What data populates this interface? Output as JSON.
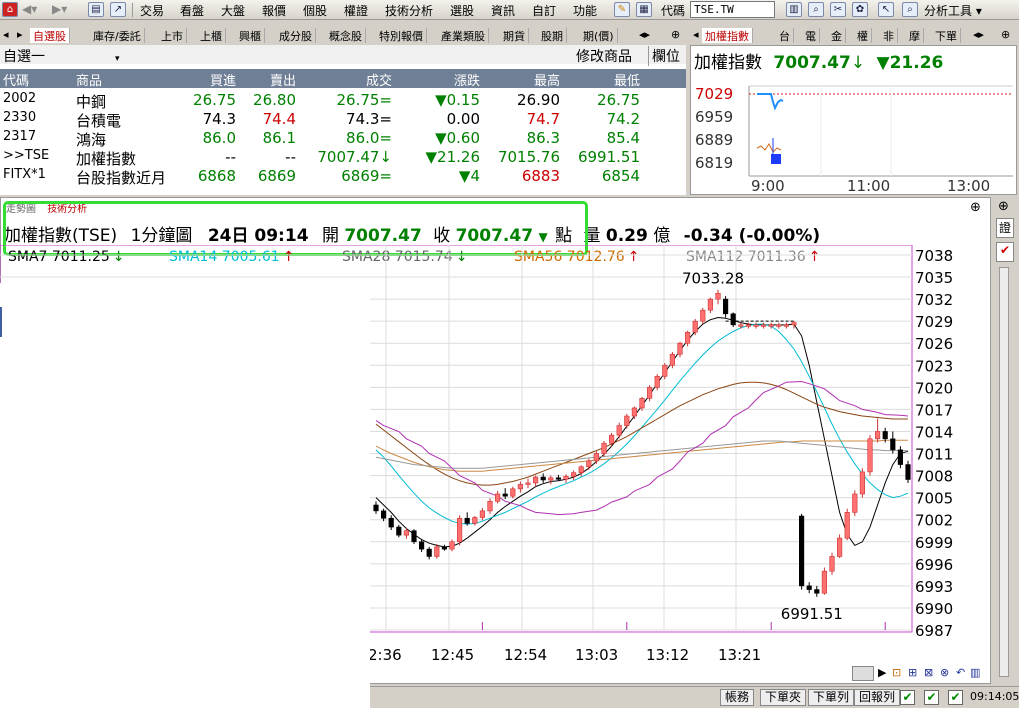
{
  "toolbar": {
    "menus": [
      "交易",
      "看盤",
      "大盤",
      "報價",
      "個股",
      "權證",
      "技術分析",
      "選股",
      "資訊",
      "自訂",
      "功能"
    ],
    "code_label": "代碼",
    "code_value": "TSE.TW",
    "analysis_tools": "分析工具"
  },
  "quote_tabs": [
    "自選股",
    "庫存/委託",
    "上市",
    "上櫃",
    "興櫃",
    "成分股",
    "概念股",
    "特別報價",
    "產業類股",
    "期貨",
    "股期",
    "期(價)"
  ],
  "quote_panel": {
    "group_select": "自選一",
    "modify_btn": "修改商品",
    "column_btn": "欄位",
    "headers": [
      "代碼",
      "商品",
      "買進",
      "賣出",
      "成交",
      "漲跌",
      "最高",
      "最低"
    ],
    "rows": [
      {
        "code": "2002",
        "name": "中鋼",
        "bid": "26.75",
        "ask": "26.80",
        "last": "26.75=",
        "chg": "▼0.15",
        "high": "26.90",
        "low": "26.75",
        "bid_c": "green",
        "ask_c": "green",
        "last_c": "green",
        "chg_c": "green",
        "high_c": "black",
        "low_c": "green"
      },
      {
        "code": "2330",
        "name": "台積電",
        "bid": "74.3",
        "ask": "74.4",
        "last": "74.3=",
        "chg": "0.00",
        "high": "74.7",
        "low": "74.2",
        "bid_c": "black",
        "ask_c": "red",
        "last_c": "black",
        "chg_c": "black",
        "high_c": "red",
        "low_c": "green"
      },
      {
        "code": "2317",
        "name": "鴻海",
        "bid": "86.0",
        "ask": "86.1",
        "last": "86.0=",
        "chg": "▼0.60",
        "high": "86.3",
        "low": "85.4",
        "bid_c": "green",
        "ask_c": "green",
        "last_c": "green",
        "chg_c": "green",
        "high_c": "green",
        "low_c": "green"
      },
      {
        "code": ">>TSE",
        "name": "加權指數",
        "bid": "--",
        "ask": "--",
        "last": "7007.47↓",
        "chg": "▼21.26",
        "high": "7015.76",
        "low": "6991.51",
        "bid_c": "black",
        "ask_c": "black",
        "last_c": "green",
        "chg_c": "green",
        "high_c": "green",
        "low_c": "green"
      },
      {
        "code": "FITX*1",
        "name": "台股指數近月",
        "bid": "6868",
        "ask": "6869",
        "last": "6869=",
        "chg": "▼4",
        "high": "6883",
        "low": "6854",
        "bid_c": "green",
        "ask_c": "green",
        "last_c": "green",
        "chg_c": "green",
        "high_c": "red",
        "low_c": "green"
      }
    ]
  },
  "mini_tabs": [
    "加權指數",
    "台",
    "電",
    "金",
    "權",
    "非",
    "摩",
    "下單"
  ],
  "mini_panel": {
    "title": "加權指數",
    "value": "7007.47",
    "arrow": "↓",
    "change": "▼21.26",
    "y_ticks": [
      "7029",
      "6959",
      "6889",
      "6819"
    ],
    "x_ticks": [
      "9:00",
      "11:00",
      "13:00"
    ]
  },
  "chart_tabs": [
    "走勢圖",
    "技術分析"
  ],
  "chart_header": {
    "name": "加權指數(TSE)",
    "period": "1分鐘圖",
    "date_time": "24日 09:14",
    "open_label": "開",
    "open_value": "7007.47",
    "close_label": "收",
    "close_value": "7007.47",
    "close_arrow": "▼",
    "unit": "點",
    "volume_label": "量",
    "volume_value": "0.29",
    "volume_unit": "億",
    "change": "-0.34 (-0.00%)"
  },
  "chart_data": {
    "type": "candlestick",
    "title": "",
    "y_ticks": [
      7038,
      7035,
      7032,
      7029,
      7026,
      7023,
      7020,
      7017,
      7014,
      7011,
      7008,
      7005,
      7002,
      6999,
      6996,
      6993,
      6990,
      6987
    ],
    "ylim": [
      6987,
      7038
    ],
    "x_ticks": [
      "2:36",
      "12:45",
      "12:54",
      "13:03",
      "13:12",
      "13:21"
    ],
    "ma_legend": [
      {
        "label": "SMA7 7011.25",
        "arrow": "↓",
        "color": "#000000"
      },
      {
        "label": "SMA14 7005.61",
        "arrow": "↑",
        "color": "#00bcd4"
      },
      {
        "label": "SMA28 7015.74",
        "arrow": "↓",
        "color": "#666666"
      },
      {
        "label": "SMA56 7012.76",
        "arrow": "↑",
        "color": "#cc6a00"
      },
      {
        "label": "SMA112 7011.36",
        "arrow": "↑",
        "color": "#888888"
      }
    ],
    "high_label": "7033.28",
    "low_label": "6991.51",
    "candles": [
      [
        7004.0,
        7004.5,
        7002.8,
        7003.2
      ],
      [
        7003.2,
        7003.5,
        7001.8,
        7002.2
      ],
      [
        7002.2,
        7002.6,
        7000.6,
        7001.0
      ],
      [
        7001.0,
        7001.3,
        6999.6,
        6999.9
      ],
      [
        6999.9,
        7000.9,
        6999.4,
        7000.5
      ],
      [
        7000.5,
        7000.7,
        6998.7,
        6999.0
      ],
      [
        6999.0,
        6999.3,
        6997.6,
        6998.0
      ],
      [
        6998.0,
        6998.3,
        6996.6,
        6997.0
      ],
      [
        6997.0,
        6998.7,
        6996.7,
        6998.3
      ],
      [
        6998.3,
        6998.6,
        6997.8,
        6998.0
      ],
      [
        6998.0,
        6999.3,
        6997.7,
        6999.0
      ],
      [
        6999.0,
        7002.6,
        6998.5,
        7002.2
      ],
      [
        7002.2,
        7003.0,
        7001.2,
        7001.5
      ],
      [
        7001.5,
        7002.5,
        7001.2,
        7002.3
      ],
      [
        7002.3,
        7003.6,
        7001.9,
        7003.2
      ],
      [
        7003.2,
        7004.9,
        7002.8,
        7004.5
      ],
      [
        7004.5,
        7005.9,
        7004.2,
        7005.5
      ],
      [
        7005.5,
        7006.3,
        7004.8,
        7005.2
      ],
      [
        7005.2,
        7006.5,
        7004.9,
        7006.2
      ],
      [
        7006.2,
        7007.2,
        7005.7,
        7006.8
      ],
      [
        7006.8,
        7007.6,
        7006.3,
        7007.0
      ],
      [
        7007.0,
        7008.0,
        7006.5,
        7007.8
      ],
      [
        7007.8,
        7008.3,
        7007.0,
        7007.4
      ],
      [
        7007.4,
        7008.0,
        7006.8,
        7007.7
      ],
      [
        7007.7,
        7008.1,
        7007.3,
        7007.5
      ],
      [
        7007.5,
        7008.2,
        7007.0,
        7007.9
      ],
      [
        7007.9,
        7008.7,
        7007.4,
        7008.4
      ],
      [
        7008.4,
        7009.4,
        7007.9,
        7009.2
      ],
      [
        7009.2,
        7010.3,
        7008.8,
        7010.0
      ],
      [
        7010.0,
        7011.3,
        7009.6,
        7011.0
      ],
      [
        7011.0,
        7012.7,
        7010.6,
        7012.4
      ],
      [
        7012.4,
        7013.8,
        7012.0,
        7013.5
      ],
      [
        7013.5,
        7015.2,
        7013.1,
        7014.8
      ],
      [
        7014.8,
        7016.4,
        7014.4,
        7016.1
      ],
      [
        7016.1,
        7017.4,
        7015.7,
        7017.2
      ],
      [
        7017.2,
        7018.7,
        7016.8,
        7018.5
      ],
      [
        7018.5,
        7020.3,
        7018.1,
        7020.0
      ],
      [
        7020.0,
        7021.8,
        7019.6,
        7021.5
      ],
      [
        7021.5,
        7023.3,
        7021.1,
        7023.0
      ],
      [
        7023.0,
        7024.8,
        7022.6,
        7024.5
      ],
      [
        7024.5,
        7026.2,
        7024.1,
        7026.0
      ],
      [
        7026.0,
        7027.7,
        7025.6,
        7027.5
      ],
      [
        7027.5,
        7029.3,
        7027.1,
        7029.0
      ],
      [
        7029.0,
        7030.8,
        7028.6,
        7030.5
      ],
      [
        7030.5,
        7032.2,
        7030.1,
        7032.0
      ],
      [
        7032.0,
        7033.28,
        7031.3,
        7032.8
      ],
      [
        7032.0,
        7032.4,
        7029.5,
        7030.0
      ],
      [
        7030.0,
        7030.2,
        7028.2,
        7028.5
      ],
      [
        7028.5,
        7028.8,
        7028.0,
        7028.5
      ],
      [
        7028.5,
        7028.8,
        7028.0,
        7028.5
      ],
      [
        7028.5,
        7028.8,
        7028.0,
        7028.5
      ],
      [
        7028.5,
        7028.8,
        7028.0,
        7028.5
      ],
      [
        7028.5,
        7028.8,
        7028.0,
        7028.5
      ],
      [
        7028.5,
        7028.8,
        7028.0,
        7028.5
      ],
      [
        7028.5,
        7028.8,
        7028.0,
        7028.5
      ],
      [
        7028.5,
        7029.0,
        7028.0,
        7028.8
      ],
      [
        7002.5,
        7002.8,
        6992.5,
        6993.0
      ],
      [
        6993.0,
        6993.5,
        6992.0,
        6992.5
      ],
      [
        6992.5,
        6993.0,
        6991.51,
        6992.0
      ],
      [
        6992.0,
        6995.5,
        6991.8,
        6995.0
      ],
      [
        6995.0,
        6997.5,
        6994.5,
        6997.0
      ],
      [
        6997.0,
        7000.0,
        6996.8,
        6999.5
      ],
      [
        6999.5,
        7003.5,
        6999.2,
        7003.0
      ],
      [
        7003.0,
        7006.0,
        7002.5,
        7005.5
      ],
      [
        7005.5,
        7009.0,
        7005.0,
        7008.5
      ],
      [
        7008.5,
        7013.5,
        7008.0,
        7013.0
      ],
      [
        7013.0,
        7015.76,
        7012.5,
        7014.0
      ],
      [
        7014.0,
        7014.5,
        7012.5,
        7013.0
      ],
      [
        7013.0,
        7014.0,
        7011.0,
        7011.5
      ],
      [
        7011.5,
        7012.0,
        7009.0,
        7009.5
      ],
      [
        7009.5,
        7010.0,
        7007.0,
        7007.47
      ]
    ],
    "ma_lines": {
      "sma7": [
        7005.0,
        7004.0,
        7003.0,
        7001.8,
        7000.8,
        7000.0,
        6999.3,
        6998.8,
        6998.5,
        6998.3,
        6998.4,
        6998.8,
        6999.5,
        7000.3,
        7001.1,
        7002.0,
        7003.0,
        7003.8,
        7004.5,
        7005.2,
        7005.8,
        7006.5,
        7006.9,
        7007.2,
        7007.3,
        7007.5,
        7007.8,
        7008.3,
        7009.0,
        7009.9,
        7010.9,
        7012.0,
        7013.3,
        7014.7,
        7016.1,
        7017.5,
        7019.0,
        7020.5,
        7022.0,
        7023.5,
        7025.0,
        7026.4,
        7027.6,
        7028.6,
        7029.2,
        7029.5,
        7029.4,
        7029.1,
        7028.8,
        7028.6,
        7028.5,
        7028.5,
        7028.5,
        7028.5,
        7028.5,
        7028.6,
        7027.0,
        7023.0,
        7018.0,
        7013.0,
        7008.0,
        7003.0,
        7000.0,
        6998.5,
        6999.0,
        7001.0,
        7004.0,
        7007.0,
        7009.5,
        7011.0,
        7011.3
      ],
      "sma14": [
        7011.5,
        7010.5,
        7009.3,
        7008.0,
        7006.8,
        7005.6,
        7004.5,
        7003.6,
        7002.9,
        7002.3,
        7001.8,
        7001.5,
        7001.4,
        7001.5,
        7001.8,
        7002.2,
        7002.6,
        7003.0,
        7003.5,
        7004.0,
        7004.5,
        7005.1,
        7005.6,
        7006.1,
        7006.5,
        7006.9,
        7007.3,
        7007.8,
        7008.3,
        7008.9,
        7009.6,
        7010.4,
        7011.3,
        7012.3,
        7013.4,
        7014.6,
        7015.8,
        7017.0,
        7018.3,
        7019.6,
        7020.9,
        7022.1,
        7023.3,
        7024.4,
        7025.4,
        7026.3,
        7027.0,
        7027.6,
        7028.1,
        7028.4,
        7028.6,
        7028.6,
        7028.3,
        7027.6,
        7026.5,
        7025.2,
        7023.5,
        7021.5,
        7019.4,
        7017.2,
        7015.0,
        7013.0,
        7011.2,
        7009.6,
        7008.2,
        7007.0,
        7006.1,
        7005.4,
        7005.0,
        7005.2,
        7005.6
      ],
      "sma28": [
        7015.0,
        7014.2,
        7013.4,
        7012.6,
        7011.8,
        7011.0,
        7010.2,
        7009.5,
        7008.8,
        7008.2,
        7007.7,
        7007.3,
        7007.0,
        7006.8,
        7006.7,
        7006.7,
        7006.8,
        7007.0,
        7007.2,
        7007.5,
        7007.8,
        7008.2,
        7008.6,
        7009.0,
        7009.4,
        7009.8,
        7010.2,
        7010.6,
        7011.0,
        7011.4,
        7011.8,
        7012.3,
        7012.8,
        7013.3,
        7013.9,
        7014.5,
        7015.1,
        7015.7,
        7016.3,
        7016.9,
        7017.5,
        7018.0,
        7018.5,
        7019.0,
        7019.4,
        7019.8,
        7020.1,
        7020.4,
        7020.6,
        7020.7,
        7020.7,
        7020.6,
        7020.4,
        7020.1,
        7019.7,
        7019.2,
        7018.7,
        7018.2,
        7017.7,
        7017.3,
        7017.0,
        7016.7,
        7016.5,
        7016.3,
        7016.1,
        7016.0,
        7015.9,
        7015.8,
        7015.7,
        7015.7,
        7015.7
      ],
      "sma56": [
        7012.0,
        7011.5,
        7011.0,
        7010.6,
        7010.2,
        7009.8,
        7009.5,
        7009.2,
        7009.0,
        7008.8,
        7008.7,
        7008.6,
        7008.6,
        7008.6,
        7008.6,
        7008.7,
        7008.8,
        7008.9,
        7009.0,
        7009.1,
        7009.2,
        7009.3,
        7009.4,
        7009.5,
        7009.6,
        7009.7,
        7009.8,
        7009.9,
        7010.0,
        7010.1,
        7010.2,
        7010.3,
        7010.4,
        7010.5,
        7010.6,
        7010.7,
        7010.8,
        7010.9,
        7011.0,
        7011.1,
        7011.2,
        7011.3,
        7011.4,
        7011.5,
        7011.6,
        7011.7,
        7011.8,
        7011.9,
        7012.0,
        7012.1,
        7012.2,
        7012.3,
        7012.4,
        7012.5,
        7012.6,
        7012.6,
        7012.7,
        7012.7,
        7012.7,
        7012.7,
        7012.7,
        7012.7,
        7012.7,
        7012.7,
        7012.7,
        7012.7,
        7012.7,
        7012.8,
        7012.8,
        7012.8,
        7012.8
      ],
      "sma112": [
        7010.5,
        7010.3,
        7010.1,
        7009.9,
        7009.7,
        7009.5,
        7009.4,
        7009.3,
        7009.2,
        7009.1,
        7009.0,
        7009.0,
        7009.0,
        7009.0,
        7009.0,
        7009.1,
        7009.2,
        7009.3,
        7009.4,
        7009.5,
        7009.6,
        7009.7,
        7009.8,
        7009.9,
        7010.0,
        7010.1,
        7010.2,
        7010.3,
        7010.4,
        7010.5,
        7010.6,
        7010.7,
        7010.8,
        7010.9,
        7011.0,
        7011.1,
        7011.2,
        7011.3,
        7011.4,
        7011.5,
        7011.6,
        7011.7,
        7011.8,
        7011.9,
        7012.0,
        7012.1,
        7012.2,
        7012.3,
        7012.4,
        7012.5,
        7012.6,
        7012.7,
        7012.7,
        7012.7,
        7012.6,
        7012.5,
        7012.4,
        7012.3,
        7012.2,
        7012.1,
        7012.0,
        7011.9,
        7011.8,
        7011.7,
        7011.6,
        7011.5,
        7011.5,
        7011.4,
        7011.4,
        7011.4,
        7011.4
      ],
      "magenta": [
        7015.5,
        7014.8,
        7014.0,
        7013.0,
        7012.0,
        7011.0,
        7010.0,
        7009.0,
        7008.0,
        7007.0,
        7006.0,
        7005.2,
        7004.5,
        7003.9,
        7003.4,
        7003.0,
        7002.8,
        7002.7,
        7002.8,
        7003.0,
        7003.3,
        7003.8,
        7004.4,
        7005.1,
        7005.9,
        7006.8,
        7007.8,
        7008.9,
        7010.0,
        7011.2,
        7012.4,
        7013.6,
        7014.8,
        7016.0,
        7017.2,
        7018.3,
        7019.3,
        7020.2,
        7020.7,
        7020.8,
        7020.5,
        7019.8,
        7019.0,
        7018.2,
        7017.5,
        7017.0,
        7016.6,
        7016.3,
        7016.2,
        7016.1
      ]
    }
  },
  "status_bar": {
    "buttons": [
      "帳務",
      "下單夾",
      "下單列",
      "回報列"
    ],
    "time": "09:14:05"
  },
  "colors": {
    "up": "#ff7070",
    "down": "#000000",
    "highlight": "#33dd33",
    "header_bg": "#6f7f95"
  }
}
